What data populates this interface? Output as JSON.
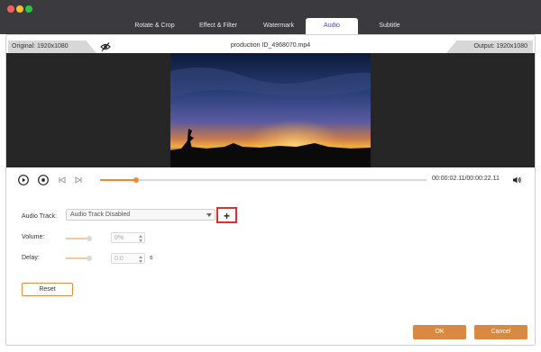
{
  "window": {
    "tabs": [
      {
        "label": "Rotate & Crop"
      },
      {
        "label": "Effect & Filter"
      },
      {
        "label": "Watermark"
      },
      {
        "label": "Audio",
        "active": true
      },
      {
        "label": "Subtitle"
      }
    ]
  },
  "info": {
    "original": "Original: 1920x1080",
    "filename": "production ID_4968070.mp4",
    "output": "Output: 1920x1080"
  },
  "player": {
    "current_time": "00:00:02.11",
    "total_time": "00:00:22.11",
    "time_display": "00:00:02.11/00:00:22.11",
    "progress_fraction": 0.11
  },
  "audio": {
    "track_label": "Audio Track:",
    "track_value": "Audio Track Disabled",
    "add_icon": "plus-icon",
    "volume_label": "Volume:",
    "volume_value": "0%",
    "delay_label": "Delay:",
    "delay_value": "0.0",
    "delay_unit": "s",
    "reset_label": "Reset"
  },
  "footer": {
    "ok_label": "OK",
    "cancel_label": "Cancel"
  },
  "colors": {
    "accent": "#e8893b",
    "button": "#d88a44",
    "highlight_box": "#d93030",
    "titlebar": "#3b3b3f"
  }
}
